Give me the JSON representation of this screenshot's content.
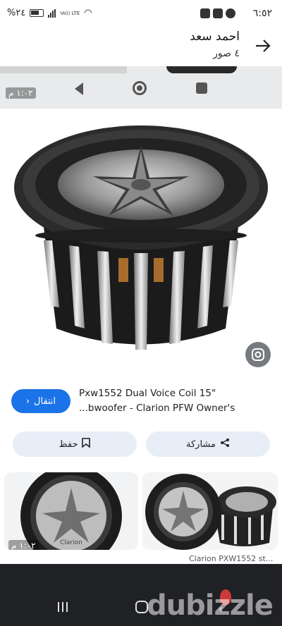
{
  "status_bar": {
    "time": "٦:٥٢",
    "battery": "%٢٤",
    "network": "Vo)) LTE"
  },
  "header": {
    "title": "احمد سعد",
    "subtitle": "٤ صور",
    "back_icon": "arrow-right-icon"
  },
  "top_strip": {
    "timestamp": "١:٠٢ م"
  },
  "result": {
    "caption_line1": "Pxw1552 Dual Voice Coil 15\"",
    "caption_line2": "...bwoofer - Clarion PFW Owner's",
    "visit_label": "انتقال",
    "save_label": "حفظ",
    "share_label": "مشاركة"
  },
  "grid": {
    "timestamp": "١:٠٢ م",
    "caption": "Clarion PXW1552 st..."
  },
  "brand": {
    "watermark": "dubizzle",
    "accent": "#1a73e8"
  }
}
